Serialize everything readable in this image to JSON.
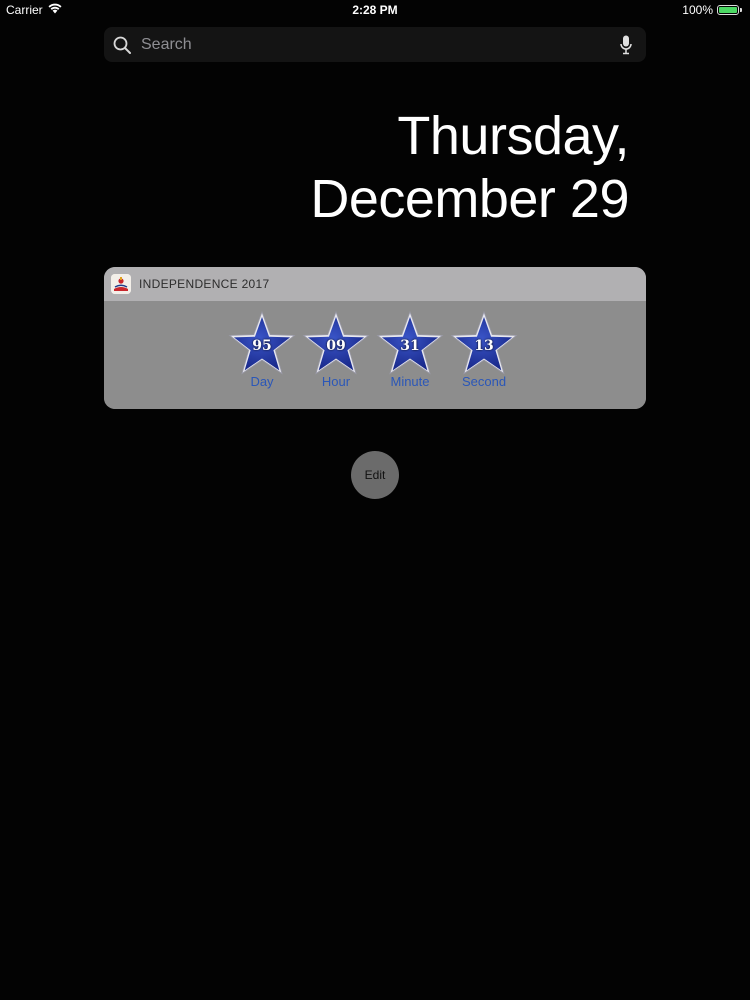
{
  "status_bar": {
    "carrier": "Carrier",
    "time": "2:28 PM",
    "battery_percent": "100%",
    "battery_level": 1.0,
    "wifi_icon": "wifi-icon"
  },
  "search": {
    "placeholder": "Search",
    "value": "",
    "icon": "search-icon",
    "mic_icon": "microphone-icon"
  },
  "date": {
    "weekday": "Thursday,",
    "month_day": "December 29"
  },
  "widget": {
    "title": "INDEPENDENCE 2017",
    "app_icon": "independence-app-icon",
    "counters": [
      {
        "value": "95",
        "label": "Day"
      },
      {
        "value": "09",
        "label": "Hour"
      },
      {
        "value": "31",
        "label": "Minute"
      },
      {
        "value": "13",
        "label": "Second"
      }
    ]
  },
  "edit_button": {
    "label": "Edit"
  },
  "colors": {
    "background": "#030303",
    "widget_header": "#b1b0b2",
    "widget_body": "#8d8d8d",
    "star_blue": "#1a2a8c",
    "label_blue": "#2b57b8",
    "battery_green": "#4cd964"
  }
}
